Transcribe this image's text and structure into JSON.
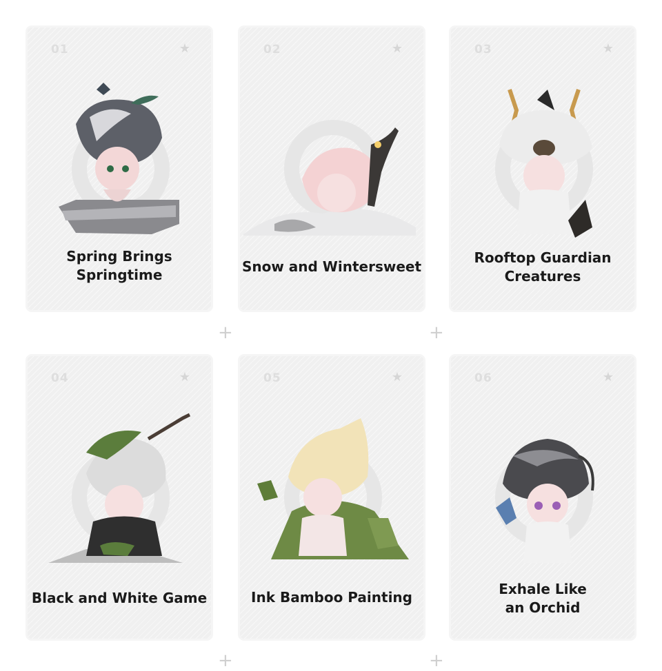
{
  "cards": [
    {
      "number": "01",
      "name": "Spring Brings\nSpringtime",
      "star_icon": "★"
    },
    {
      "number": "02",
      "name": "Snow and Wintersweet",
      "star_icon": "★"
    },
    {
      "number": "03",
      "name": "Rooftop Guardian\nCreatures",
      "star_icon": "★"
    },
    {
      "number": "04",
      "name": "Black and White Game",
      "star_icon": "★"
    },
    {
      "number": "05",
      "name": "Ink Bamboo Painting",
      "star_icon": "★"
    },
    {
      "number": "06",
      "name": "Exhale Like\nan Orchid",
      "star_icon": "★"
    }
  ],
  "separator_icon": "+",
  "colors": {
    "card_bg": "#f0f0f0",
    "text": "#1a1a1a",
    "muted": "#dedede"
  }
}
